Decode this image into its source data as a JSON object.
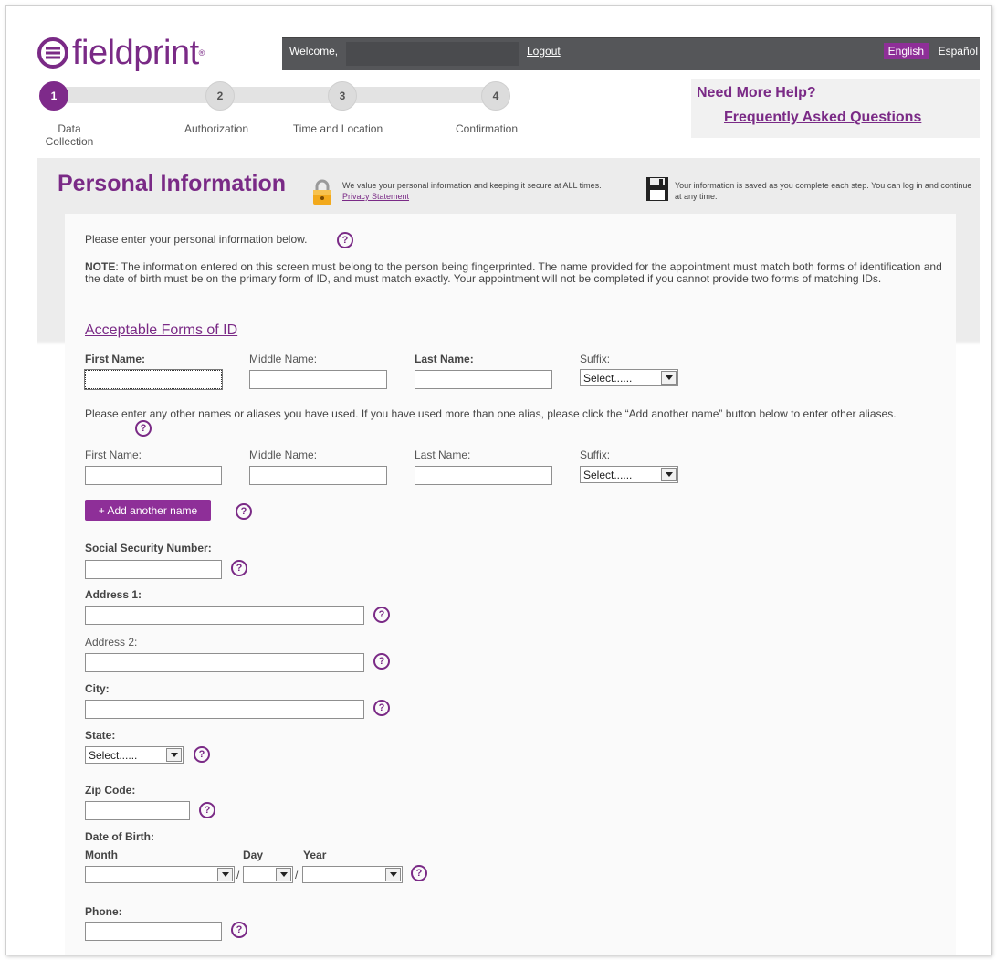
{
  "brand": {
    "name": "fieldprint",
    "tm": "®"
  },
  "topbar": {
    "welcome": "Welcome,",
    "logout": "Logout",
    "lang_en": "English",
    "lang_es": "Español"
  },
  "steps": [
    {
      "num": "1",
      "label": "Data Collection"
    },
    {
      "num": "2",
      "label": "Authorization"
    },
    {
      "num": "3",
      "label": "Time and Location"
    },
    {
      "num": "4",
      "label": "Confirmation"
    }
  ],
  "help": {
    "title": "Need More Help?",
    "faq": "Frequently Asked Questions"
  },
  "section": {
    "title": "Personal Information",
    "security_text": "We value your personal information and keeping it secure at ALL times.",
    "privacy_link": "Privacy Statement",
    "save_text": "Your information is saved as you complete each step. You can log in and continue at any time."
  },
  "form": {
    "intro": "Please enter your personal information below.",
    "note_label": "NOTE",
    "note_text": ": The information entered on this screen must belong to the person being fingerprinted. The name provided for the appointment must match both forms of identification and the date of birth must be on the primary form of ID, and must match exactly. Your appointment will not be completed if you cannot provide two forms of matching IDs.",
    "acceptable_id_link": "Acceptable Forms of ID",
    "labels": {
      "first_name": "First Name:",
      "middle_name": "Middle Name:",
      "last_name": "Last Name:",
      "suffix": "Suffix:",
      "ssn": "Social Security Number:",
      "address1": "Address 1:",
      "address2": "Address 2:",
      "city": "City:",
      "state": "State:",
      "zip": "Zip Code:",
      "dob": "Date of Birth:",
      "month": "Month",
      "day": "Day",
      "year": "Year",
      "phone": "Phone:"
    },
    "alias_text": "Please enter any other names or aliases you have used. If you have used more than one alias, please click the “Add another name” button below to enter other aliases.",
    "add_name_button": "+ Add another name",
    "select_placeholder": "Select......",
    "date_separator": "/",
    "help_glyph": "?",
    "dropdown_arrow": "▼"
  },
  "icons": {
    "logo": "fieldprint-logo-icon",
    "lock": "lock-icon",
    "save": "floppy-disk-icon",
    "help": "question-circle-icon"
  },
  "colors": {
    "brand_purple": "#7a2a86",
    "button_purple": "#8e2f98",
    "topbar": "#555659"
  }
}
